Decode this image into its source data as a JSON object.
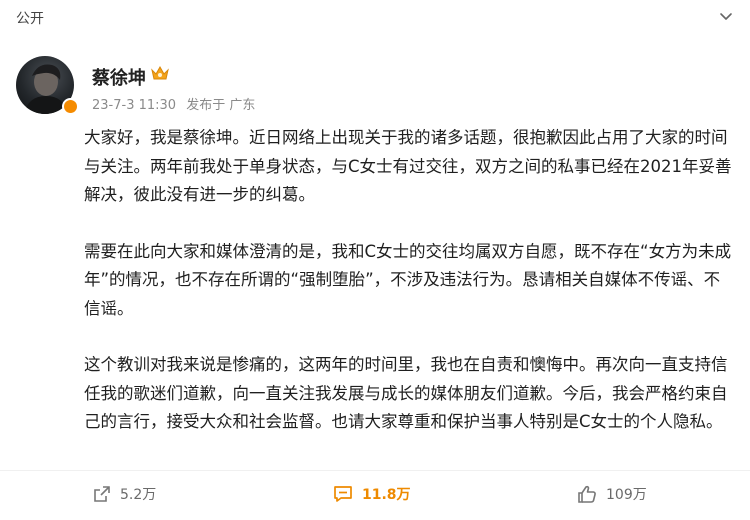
{
  "header": {
    "visibility_label": "公开"
  },
  "author": {
    "name": "蔡徐坤",
    "date": "23-7-3 11:30",
    "posted_from": "发布于 广东"
  },
  "post": {
    "paragraphs": [
      "大家好，我是蔡徐坤。近日网络上出现关于我的诸多话题，很抱歉因此占用了大家的时间与关注。两年前我处于单身状态，与C女士有过交往，双方之间的私事已经在2021年妥善解决，彼此没有进一步的纠葛。",
      "需要在此向大家和媒体澄清的是，我和C女士的交往均属双方自愿，既不存在“女方为未成年”的情况，也不存在所谓的“强制堕胎”，不涉及违法行为。恳请相关自媒体不传谣、不信谣。",
      "这个教训对我来说是惨痛的，这两年的时间里，我也在自责和懊悔中。再次向一直支持信任我的歌迷们道歉，向一直关注我发展与成长的媒体朋友们道歉。今后，我会严格约束自己的言行，接受大众和社会监督。也请大家尊重和保护当事人特别是C女士的个人隐私。"
    ]
  },
  "actions": {
    "share_count": "5.2万",
    "comment_count": "11.8万",
    "like_count": "109万"
  },
  "colors": {
    "accent": "#ee8a00",
    "muted": "#8a8a8a"
  },
  "icons": [
    "chevron-down-icon",
    "verified-badge-icon",
    "vip-crown-icon",
    "share-icon",
    "comment-icon",
    "like-icon"
  ]
}
